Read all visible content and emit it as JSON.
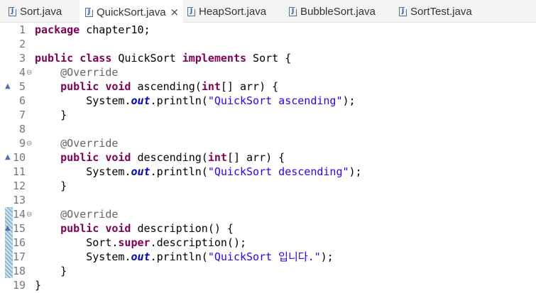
{
  "tabs": [
    {
      "label": "Sort.java",
      "active": false
    },
    {
      "label": "QuickSort.java",
      "active": true,
      "close": "×"
    },
    {
      "label": "HeapSort.java",
      "active": false
    },
    {
      "label": "BubbleSort.java",
      "active": false
    },
    {
      "label": "SortTest.java",
      "active": false
    }
  ],
  "tab_icon": "J",
  "lines": [
    {
      "n": "1",
      "tokens": [
        [
          "kw",
          "package"
        ],
        [
          "t",
          " chapter10;"
        ]
      ]
    },
    {
      "n": "2",
      "tokens": []
    },
    {
      "n": "3",
      "tokens": [
        [
          "kw",
          "public"
        ],
        [
          "t",
          " "
        ],
        [
          "kw",
          "class"
        ],
        [
          "t",
          " QuickSort "
        ],
        [
          "kw",
          "implements"
        ],
        [
          "t",
          " Sort {"
        ]
      ]
    },
    {
      "n": "4",
      "fold": "⊖",
      "tokens": [
        [
          "t",
          "    "
        ],
        [
          "ann",
          "@Override"
        ]
      ]
    },
    {
      "n": "5",
      "override": "▲",
      "tokens": [
        [
          "t",
          "    "
        ],
        [
          "kw",
          "public"
        ],
        [
          "t",
          " "
        ],
        [
          "kw",
          "void"
        ],
        [
          "t",
          " ascending("
        ],
        [
          "kw",
          "int"
        ],
        [
          "t",
          "[] arr) {"
        ]
      ]
    },
    {
      "n": "6",
      "tokens": [
        [
          "t",
          "        System."
        ],
        [
          "fld",
          "out"
        ],
        [
          "t",
          ".println("
        ],
        [
          "str",
          "\"QuickSort ascending\""
        ],
        [
          "t",
          ");"
        ]
      ]
    },
    {
      "n": "7",
      "tokens": [
        [
          "t",
          "    }"
        ]
      ]
    },
    {
      "n": "8",
      "tokens": []
    },
    {
      "n": "9",
      "fold": "⊖",
      "tokens": [
        [
          "t",
          "    "
        ],
        [
          "ann",
          "@Override"
        ]
      ]
    },
    {
      "n": "10",
      "override": "▲",
      "tokens": [
        [
          "t",
          "    "
        ],
        [
          "kw",
          "public"
        ],
        [
          "t",
          " "
        ],
        [
          "kw",
          "void"
        ],
        [
          "t",
          " descending("
        ],
        [
          "kw",
          "int"
        ],
        [
          "t",
          "[] arr) {"
        ]
      ]
    },
    {
      "n": "11",
      "tokens": [
        [
          "t",
          "        System."
        ],
        [
          "fld",
          "out"
        ],
        [
          "t",
          ".println("
        ],
        [
          "str",
          "\"QuickSort descending\""
        ],
        [
          "t",
          ");"
        ]
      ]
    },
    {
      "n": "12",
      "tokens": [
        [
          "t",
          "    }"
        ]
      ]
    },
    {
      "n": "13",
      "tokens": []
    },
    {
      "n": "14",
      "fold": "⊖",
      "tokens": [
        [
          "t",
          "    "
        ],
        [
          "ann",
          "@Override"
        ]
      ]
    },
    {
      "n": "15",
      "override": "▲",
      "tokens": [
        [
          "t",
          "    "
        ],
        [
          "kw",
          "public"
        ],
        [
          "t",
          " "
        ],
        [
          "kw",
          "void"
        ],
        [
          "t",
          " description() {"
        ]
      ]
    },
    {
      "n": "16",
      "tokens": [
        [
          "t",
          "        Sort."
        ],
        [
          "kw",
          "super"
        ],
        [
          "t",
          ".description();"
        ]
      ]
    },
    {
      "n": "17",
      "tokens": [
        [
          "t",
          "        System."
        ],
        [
          "fld",
          "out"
        ],
        [
          "t",
          ".println("
        ],
        [
          "str",
          "\"QuickSort 입니다.\""
        ],
        [
          "t",
          ");"
        ]
      ]
    },
    {
      "n": "18",
      "tokens": [
        [
          "t",
          "    }"
        ]
      ]
    },
    {
      "n": "19",
      "tokens": [
        [
          "t",
          "}"
        ]
      ]
    }
  ],
  "change_marker": {
    "from_line": 14,
    "to_line": 18,
    "color": "#a9cde0"
  },
  "colors": {
    "keyword": "#7f0055",
    "annotation": "#646464",
    "string": "#2a00ff",
    "field": "#0000c0"
  }
}
